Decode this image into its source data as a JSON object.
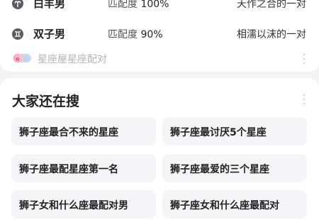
{
  "matches": [
    {
      "icon": "aries-icon",
      "sign": "白羊男",
      "score_label": "匹配度",
      "score_value": "100%",
      "description": "天作之合的一对"
    },
    {
      "icon": "gemini-icon",
      "sign": "双子男",
      "score_label": "匹配度",
      "score_value": "90%",
      "description": "相濡以沫的一对"
    }
  ],
  "source": {
    "logo": "xingzuowu-logo",
    "label": "星座屋星座配对"
  },
  "related": {
    "title": "大家还在搜",
    "items": [
      "狮子座最合不来的星座",
      "狮子座最讨厌5个星座",
      "狮子座最配星座第一名",
      "狮子座最爱的三个星座",
      "狮子女和什么座最配对男",
      "狮子座女和什么座最配对"
    ]
  }
}
